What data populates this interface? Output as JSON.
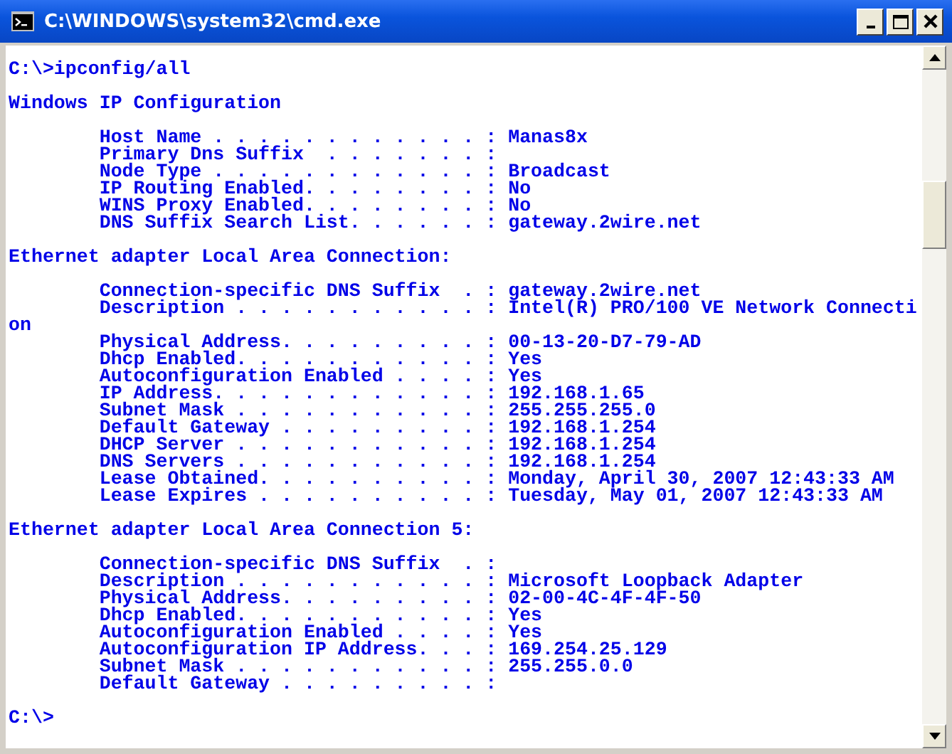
{
  "window": {
    "title": "C:\\WINDOWS\\system32\\cmd.exe"
  },
  "console": {
    "blocks": [
      [
        "C:\\>ipconfig/all"
      ],
      [
        "Windows IP Configuration"
      ],
      [
        "        Host Name . . . . . . . . . . . . : Manas8x",
        "        Primary Dns Suffix  . . . . . . . :",
        "        Node Type . . . . . . . . . . . . : Broadcast",
        "        IP Routing Enabled. . . . . . . . : No",
        "        WINS Proxy Enabled. . . . . . . . : No",
        "        DNS Suffix Search List. . . . . . : gateway.2wire.net"
      ],
      [
        "Ethernet adapter Local Area Connection:"
      ],
      [
        "        Connection-specific DNS Suffix  . : gateway.2wire.net",
        "        Description . . . . . . . . . . . : Intel(R) PRO/100 VE Network Connecti",
        "on",
        "        Physical Address. . . . . . . . . : 00-13-20-D7-79-AD",
        "        Dhcp Enabled. . . . . . . . . . . : Yes",
        "        Autoconfiguration Enabled . . . . : Yes",
        "        IP Address. . . . . . . . . . . . : 192.168.1.65",
        "        Subnet Mask . . . . . . . . . . . : 255.255.255.0",
        "        Default Gateway . . . . . . . . . : 192.168.1.254",
        "        DHCP Server . . . . . . . . . . . : 192.168.1.254",
        "        DNS Servers . . . . . . . . . . . : 192.168.1.254",
        "        Lease Obtained. . . . . . . . . . : Monday, April 30, 2007 12:43:33 AM",
        "        Lease Expires . . . . . . . . . . : Tuesday, May 01, 2007 12:43:33 AM"
      ],
      [
        "Ethernet adapter Local Area Connection 5:"
      ],
      [
        "        Connection-specific DNS Suffix  . :",
        "        Description . . . . . . . . . . . : Microsoft Loopback Adapter",
        "        Physical Address. . . . . . . . . : 02-00-4C-4F-4F-50",
        "        Dhcp Enabled. . . . . . . . . . . : Yes",
        "        Autoconfiguration Enabled . . . . : Yes",
        "        Autoconfiguration IP Address. . . : 169.254.25.129",
        "        Subnet Mask . . . . . . . . . . . : 255.255.0.0",
        "        Default Gateway . . . . . . . . . :"
      ],
      [
        "C:\\>"
      ]
    ]
  }
}
